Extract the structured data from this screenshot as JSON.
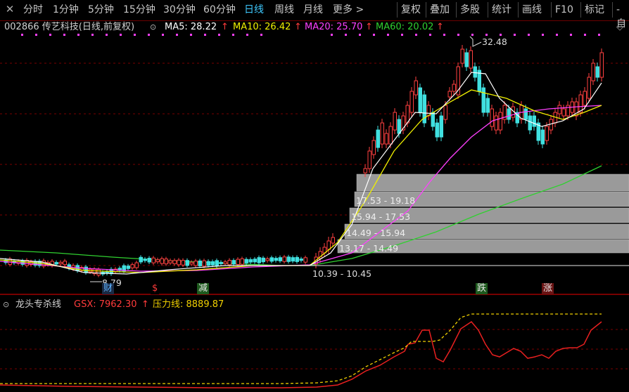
{
  "toolbar": {
    "close_glyph": "✕",
    "periods": [
      "分时",
      "1分钟",
      "5分钟",
      "15分钟",
      "30分钟",
      "60分钟",
      "日线",
      "周线",
      "月线",
      "更多 >"
    ],
    "active_period": "日线",
    "tools": [
      "复权",
      "叠加",
      "多股",
      "统计",
      "画线",
      "F10",
      "标记",
      "-自"
    ]
  },
  "main_info": {
    "stock": "002866 传艺科技(日线,前复权)",
    "ma5": "MA5: 28.22",
    "ma10": "MA10: 26.42",
    "ma20": "MA20: 25.70",
    "ma60": "MA60: 20.02",
    "arrow": "↑",
    "collapse_icon": "◇"
  },
  "chart_labels": {
    "high": "32.48",
    "low": "8.79",
    "base_range": "10.39 - 10.45"
  },
  "volume_profile": [
    {
      "range": "",
      "width_from": 507
    },
    {
      "range": "17.53 - 19.18",
      "width_from": 504
    },
    {
      "range": "15.94 - 17.53",
      "width_from": 497
    },
    {
      "range": "14.49 - 15.94",
      "width_from": 490
    },
    {
      "range": "13.17 - 14.49",
      "width_from": 480
    }
  ],
  "markers": [
    {
      "text": "财",
      "color": "#5fb4ff",
      "bg": "#1a2a44"
    },
    {
      "text": "$",
      "color": "#ff3b3b",
      "bg": "#000"
    },
    {
      "text": "减",
      "color": "#e6e6e6",
      "bg": "#1e5a1e"
    },
    {
      "text": "跌",
      "color": "#e6e6e6",
      "bg": "#1e5a1e"
    },
    {
      "text": "涨",
      "color": "#e6e6e6",
      "bg": "#6a1414"
    }
  ],
  "sub_info": {
    "indicator": "龙头专杀线",
    "gsx": "GSX: 7962.30",
    "gsx_arrow": "↑",
    "pressure": "压力线: 8889.87"
  },
  "colors": {
    "ma5": "#ffffff",
    "ma10": "#f0f000",
    "ma20": "#ff40ff",
    "ma60": "#30d030",
    "up": "#ff4040",
    "down": "#40e0e0",
    "grid": "#7a0000"
  }
}
